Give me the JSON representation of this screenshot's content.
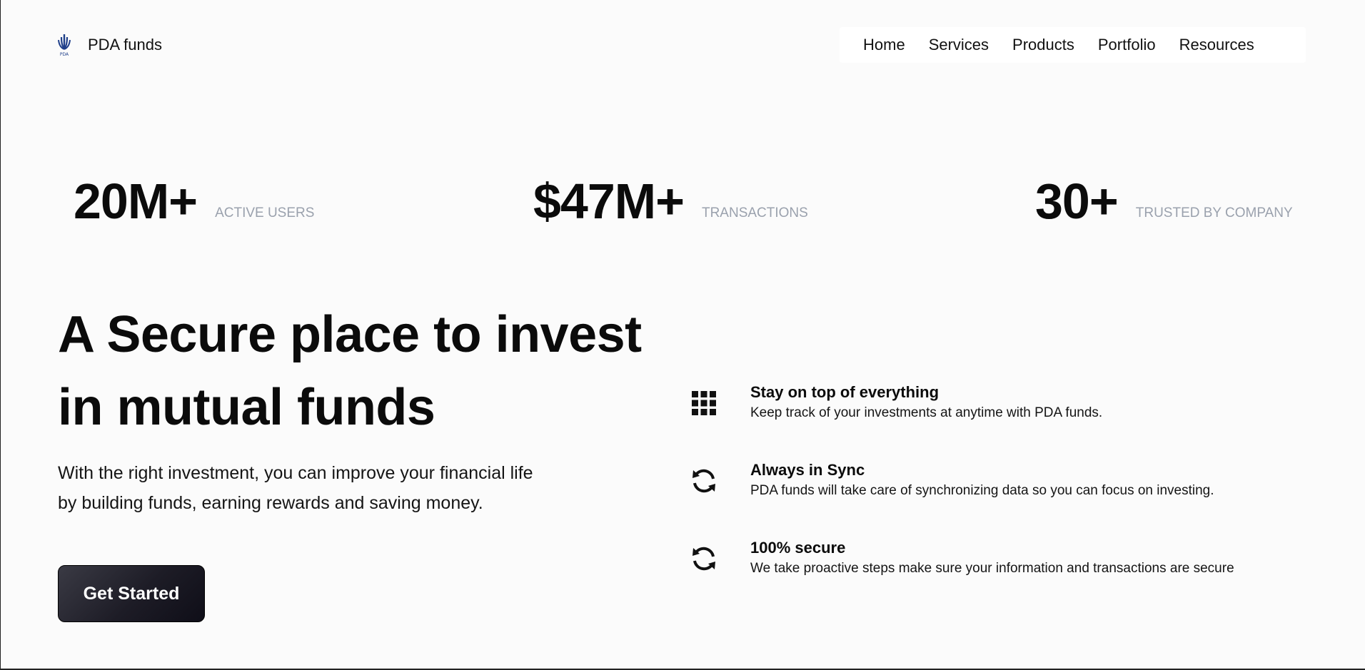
{
  "brand": {
    "name": "PDA funds",
    "logo_icon": "pda-logo-icon",
    "logo_text": "PDA"
  },
  "nav": {
    "items": [
      "Home",
      "Services",
      "Products",
      "Portfolio",
      "Resources"
    ]
  },
  "stats": [
    {
      "value": "20M+",
      "label": "ACTIVE USERS"
    },
    {
      "value": "$47M+",
      "label": "TRANSACTIONS"
    },
    {
      "value": "30+",
      "label": "TRUSTED BY COMPANY"
    }
  ],
  "hero": {
    "title_line1": "A Secure place to invest",
    "title_line2": "in mutual funds",
    "description": "With the right investment, you can improve your financial life by building funds, earning rewards and saving money.",
    "cta_label": "Get Started"
  },
  "features": [
    {
      "icon": "grid-icon",
      "title": "Stay on top of everything",
      "description": "Keep track of your investments at anytime with PDA funds."
    },
    {
      "icon": "sync-icon",
      "title": "Always in Sync",
      "description": "PDA funds will take care of synchronizing data so you can focus on investing."
    },
    {
      "icon": "sync-icon",
      "title": "100% secure",
      "description": "We take proactive steps make sure your information and transactions are secure"
    }
  ],
  "colors": {
    "background": "#fbfbfb",
    "text": "#111111",
    "muted": "#9aa1ad",
    "logo": "#1f3f8a",
    "button": "#1d1c26"
  }
}
